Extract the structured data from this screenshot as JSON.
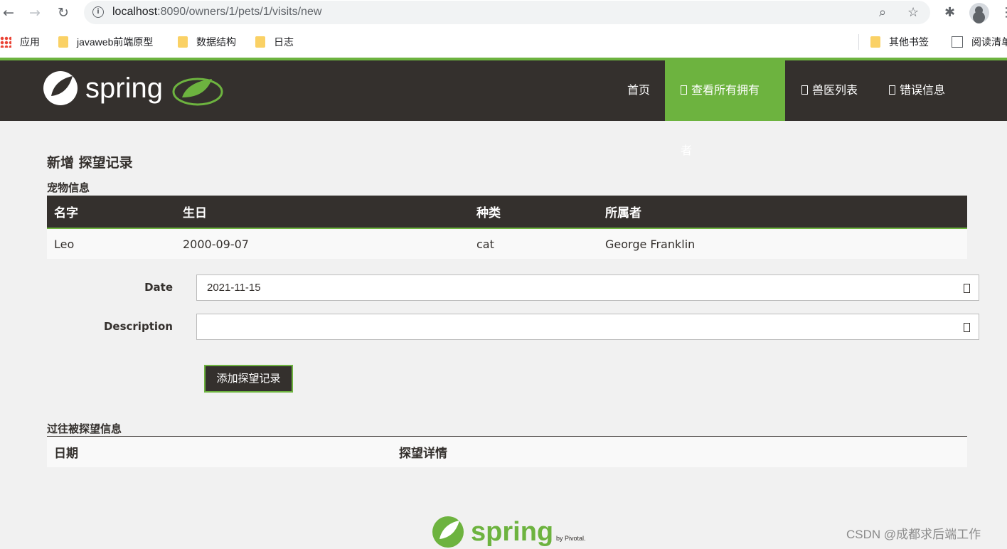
{
  "browser": {
    "url_host": "localhost",
    "url_path": ":8090/owners/1/pets/1/visits/new",
    "bookmarks": [
      {
        "label": "应用",
        "type": "apps"
      },
      {
        "label": "javaweb前端原型",
        "type": "folder"
      },
      {
        "label": "数据结构",
        "type": "folder"
      },
      {
        "label": "日志",
        "type": "folder"
      }
    ],
    "other_bookmarks": "其他书签",
    "reading_list": "阅读清单"
  },
  "navbar": {
    "brand": "spring",
    "items": [
      {
        "label": "首页",
        "active": false,
        "icon": "home-icon"
      },
      {
        "label": "查看所有拥有者",
        "active": true,
        "icon": "search-icon"
      },
      {
        "label": "兽医列表",
        "active": false,
        "icon": "list-icon"
      },
      {
        "label": "错误信息",
        "active": false,
        "icon": "warning-icon"
      }
    ]
  },
  "page": {
    "title": "新增 探望记录",
    "pet_section": "宠物信息",
    "pet_columns": [
      "名字",
      "生日",
      "种类",
      "所属者"
    ],
    "pet_row": [
      "Leo",
      "2000-09-07",
      "cat",
      "George Franklin"
    ],
    "form": {
      "date_label": "Date",
      "date_value": "2021-11-15",
      "description_label": "Description",
      "description_value": "",
      "submit_label": "添加探望记录"
    },
    "previous_section": "过往被探望信息",
    "visit_columns": [
      "日期",
      "探望详情"
    ]
  },
  "footer": {
    "brand": "spring",
    "by": "by Pivotal."
  },
  "watermark": "CSDN @成都求后端工作",
  "colors": {
    "spring_green": "#6db33f",
    "dark": "#34302d",
    "background": "#f1f1f1"
  }
}
